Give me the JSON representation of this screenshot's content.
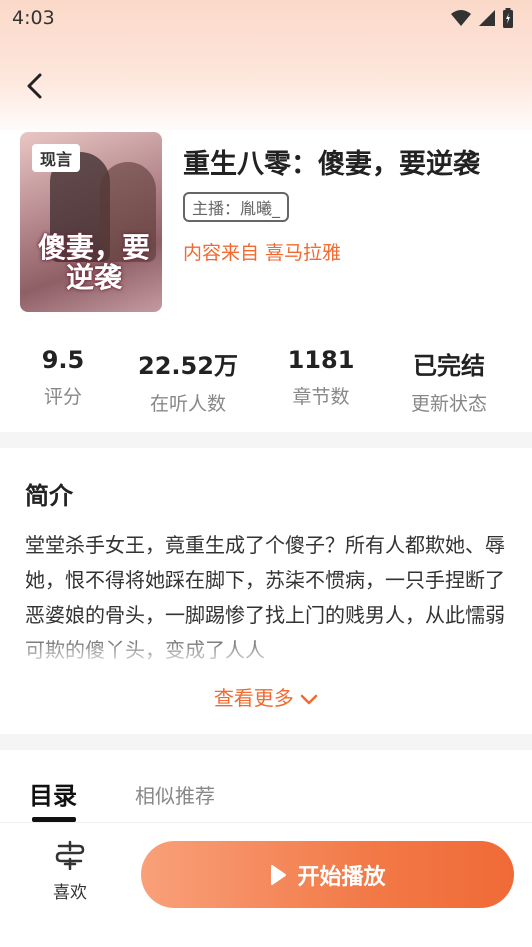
{
  "status_bar": {
    "time": "4:03"
  },
  "book": {
    "cover_tag": "现言",
    "cover_title": "傻妻，要逆袭",
    "title": "重生八零：傻妻，要逆袭",
    "narrator": "主播：胤曦_",
    "source": "内容来自 喜马拉雅"
  },
  "stats": [
    {
      "value": "9.5",
      "label": "评分"
    },
    {
      "value": "22.52万",
      "label": "在听人数"
    },
    {
      "value": "1181",
      "label": "章节数"
    },
    {
      "value": "已完结",
      "label": "更新状态"
    }
  ],
  "intro": {
    "heading": "简介",
    "text": "堂堂杀手女王，竟重生成了个傻子？所有人都欺她、辱她，恨不得将她踩在脚下，苏柒不惯病，一只手捏断了恶婆娘的骨头，一脚踢惨了找上门的贱男人，从此懦弱可欺的傻丫头，变成了人人",
    "more_label": "查看更多"
  },
  "tabs": {
    "active": "目录",
    "other": "相似推荐"
  },
  "bottom": {
    "like_label": "喜欢",
    "play_label": "开始播放"
  },
  "colors": {
    "accent": "#f26a2f",
    "play_gradient_start": "#f9a07a",
    "play_gradient_end": "#f06a36"
  }
}
